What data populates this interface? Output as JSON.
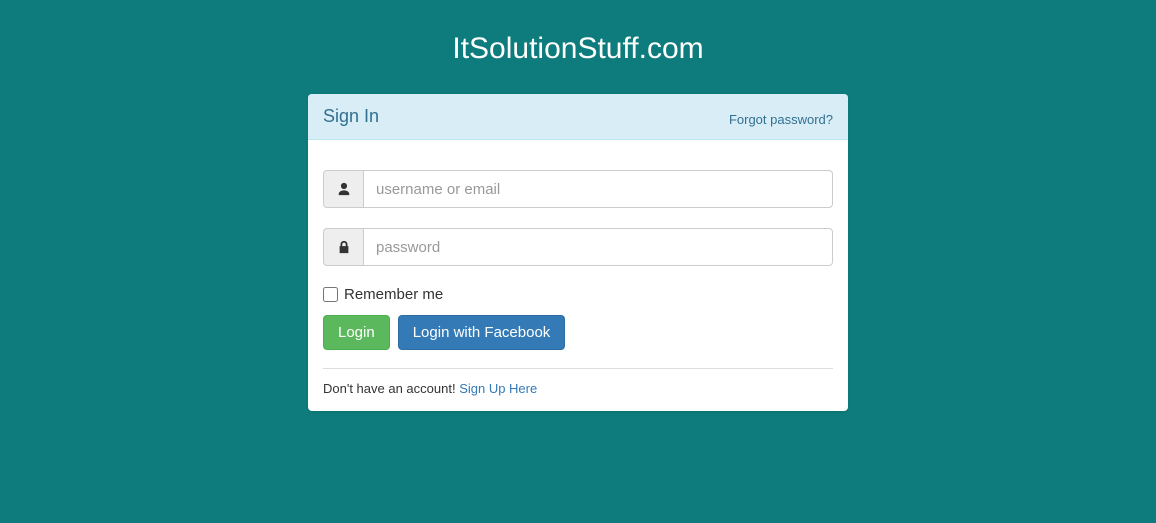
{
  "header": {
    "title": "ItSolutionStuff.com"
  },
  "panel": {
    "title": "Sign In",
    "forgot_link": "Forgot password?"
  },
  "form": {
    "username_placeholder": "username or email",
    "password_placeholder": "password",
    "remember_label": "Remember me",
    "login_button": "Login",
    "facebook_button": "Login with Facebook"
  },
  "footer": {
    "no_account_text": "Don't have an account! ",
    "signup_link": "Sign Up Here"
  }
}
